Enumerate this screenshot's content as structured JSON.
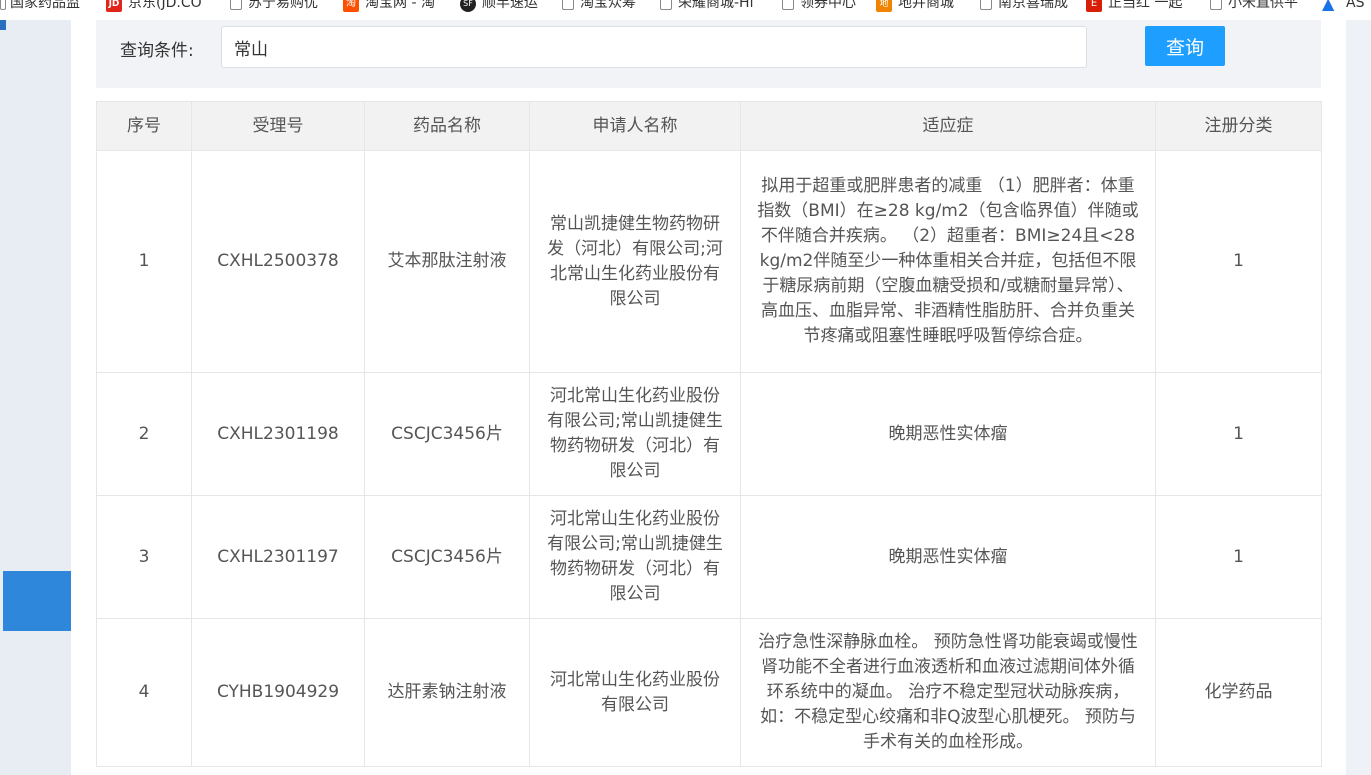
{
  "bookmarks": [
    {
      "label": "国家药品监",
      "icon": "page-icon"
    },
    {
      "label": "京东(JD.CO",
      "icon": "jd-icon"
    },
    {
      "label": "苏宁易购优",
      "icon": "page-icon"
    },
    {
      "label": "淘宝网 - 淘",
      "icon": "taobao-icon"
    },
    {
      "label": "顺丰速运",
      "icon": "sf-icon"
    },
    {
      "label": "淘宝众筹",
      "icon": "page-icon"
    },
    {
      "label": "荣耀商城-Hi",
      "icon": "page-icon"
    },
    {
      "label": "领券中心",
      "icon": "page-icon"
    },
    {
      "label": "地井商城",
      "icon": "dijing-icon"
    },
    {
      "label": "南京喜瑞成",
      "icon": "page-icon"
    },
    {
      "label": "正当红 一起",
      "icon": "red-icon"
    },
    {
      "label": "小米直供平",
      "icon": "page-icon"
    },
    {
      "label": "AS",
      "icon": "asus-icon"
    }
  ],
  "search": {
    "label": "查询条件:",
    "value": "常山",
    "button": "查询"
  },
  "table": {
    "headers": [
      "序号",
      "受理号",
      "药品名称",
      "申请人名称",
      "适应症",
      "注册分类"
    ],
    "rows": [
      {
        "index": "1",
        "acceptance_no": "CXHL2500378",
        "drug_name": "艾本那肽注射液",
        "applicant": "常山凯捷健生物药物研发（河北）有限公司;河北常山生化药业股份有限公司",
        "indication": "拟用于超重或肥胖患者的减重 （1）肥胖者：体重指数（BMI）在≥28 kg/m2（包含临界值）伴随或不伴随合并疾病。 （2）超重者：BMI≥24且<28 kg/m2伴随至少一种体重相关合并症，包括但不限于糖尿病前期（空腹血糖受损和/或糖耐量异常）、高血压、血脂异常、非酒精性脂肪肝、合并负重关节疼痛或阻塞性睡眠呼吸暂停综合症。",
        "registration_class": "1"
      },
      {
        "index": "2",
        "acceptance_no": "CXHL2301198",
        "drug_name": "CSCJC3456片",
        "applicant": "河北常山生化药业股份有限公司;常山凯捷健生物药物研发（河北）有限公司",
        "indication": "晚期恶性实体瘤",
        "registration_class": "1"
      },
      {
        "index": "3",
        "acceptance_no": "CXHL2301197",
        "drug_name": "CSCJC3456片",
        "applicant": "河北常山生化药业股份有限公司;常山凯捷健生物药物研发（河北）有限公司",
        "indication": "晚期恶性实体瘤",
        "registration_class": "1"
      },
      {
        "index": "4",
        "acceptance_no": "CYHB1904929",
        "drug_name": "达肝素钠注射液",
        "applicant": "河北常山生化药业股份有限公司",
        "indication": "治疗急性深静脉血栓。 预防急性肾功能衰竭或慢性肾功能不全者进行血液透析和血液过滤期间体外循环系统中的凝血。 治疗不稳定型冠状动脉疾病，如：不稳定型心绞痛和非Q波型心肌梗死。 预防与手术有关的血栓形成。",
        "registration_class": "化学药品"
      }
    ]
  }
}
